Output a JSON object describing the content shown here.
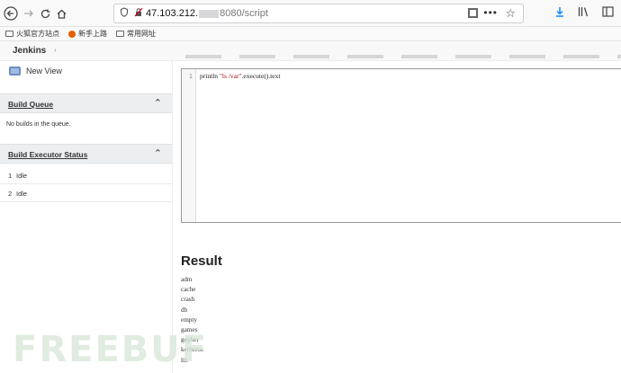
{
  "browser": {
    "url_host": "47.103.212.",
    "url_path": "8080/script",
    "icons": {
      "back": "back-arrow-icon",
      "forward": "forward-arrow-icon",
      "reload": "reload-icon",
      "home": "home-icon",
      "shield": "shield-icon",
      "lock": "insecure-lock-icon",
      "qr": "qr-code-icon",
      "more": "more-dots-icon",
      "bookmark": "star-icon",
      "download": "download-icon",
      "library": "library-icon",
      "sidebar": "sidebar-icon"
    }
  },
  "bookmarks": [
    {
      "label": "火狐官方站点",
      "icon": "folder-icon"
    },
    {
      "label": "新手上路",
      "icon": "firefox-icon"
    },
    {
      "label": "常用网址",
      "icon": "folder-icon"
    }
  ],
  "header": {
    "breadcrumb": "Jenkins",
    "chevron": "›"
  },
  "sidebar": {
    "new_view": "New View",
    "build_queue": {
      "title": "Build Queue",
      "empty_text": "No builds in the queue."
    },
    "executor_status": {
      "title": "Build Executor Status",
      "executors": [
        {
          "number": "1",
          "status": "Idle"
        },
        {
          "number": "2",
          "status": "Idle"
        }
      ]
    },
    "collapse_glyph": "⌃"
  },
  "editor": {
    "line_number": "1",
    "code_prefix": "println ",
    "code_string": "\"ls /var\"",
    "code_suffix": ".execute().text"
  },
  "result": {
    "title": "Result",
    "lines": [
      "adm",
      "cache",
      "crash",
      "db",
      "empty",
      "games",
      "gopher",
      "kerberos",
      "lib"
    ]
  },
  "watermark": "FREEBUF"
}
